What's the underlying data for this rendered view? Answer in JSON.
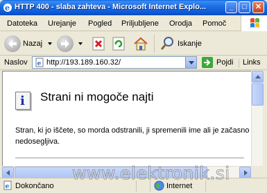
{
  "window": {
    "title": "HTTP 400 - slaba zahteva - Microsoft Internet Explo...",
    "controls": {
      "minimize": "_",
      "maximize": "□",
      "close": "✕"
    }
  },
  "menubar": {
    "items": [
      "Datoteka",
      "Urejanje",
      "Pogled",
      "Priljubljene",
      "Orodja",
      "Pomoč"
    ]
  },
  "toolbar": {
    "back_label": "Nazaj",
    "search_label": "Iskanje"
  },
  "addressbar": {
    "label": "Naslov",
    "url": "http://193.189.160.32/",
    "go_label": "Pojdi",
    "links_label": "Links"
  },
  "page": {
    "heading": "Strani ni mogoče najti",
    "body": "Stran, ki jo iščete, so morda odstranili, ji spremenili ime ali je začasno nedosegljiva."
  },
  "statusbar": {
    "status": "Dokončano",
    "zone": "Internet"
  },
  "watermark": "www.elektronik.si",
  "colors": {
    "titlebar": "#0a55d0",
    "chrome": "#ece9d8",
    "info_icon": "#1a2ea0"
  },
  "icons": [
    "internet-explorer-icon",
    "windows-logo-icon",
    "back-arrow-icon",
    "forward-arrow-icon",
    "stop-icon",
    "refresh-icon",
    "home-icon",
    "search-magnifier-icon",
    "page-icon",
    "go-arrow-icon",
    "info-icon",
    "globe-icon"
  ]
}
